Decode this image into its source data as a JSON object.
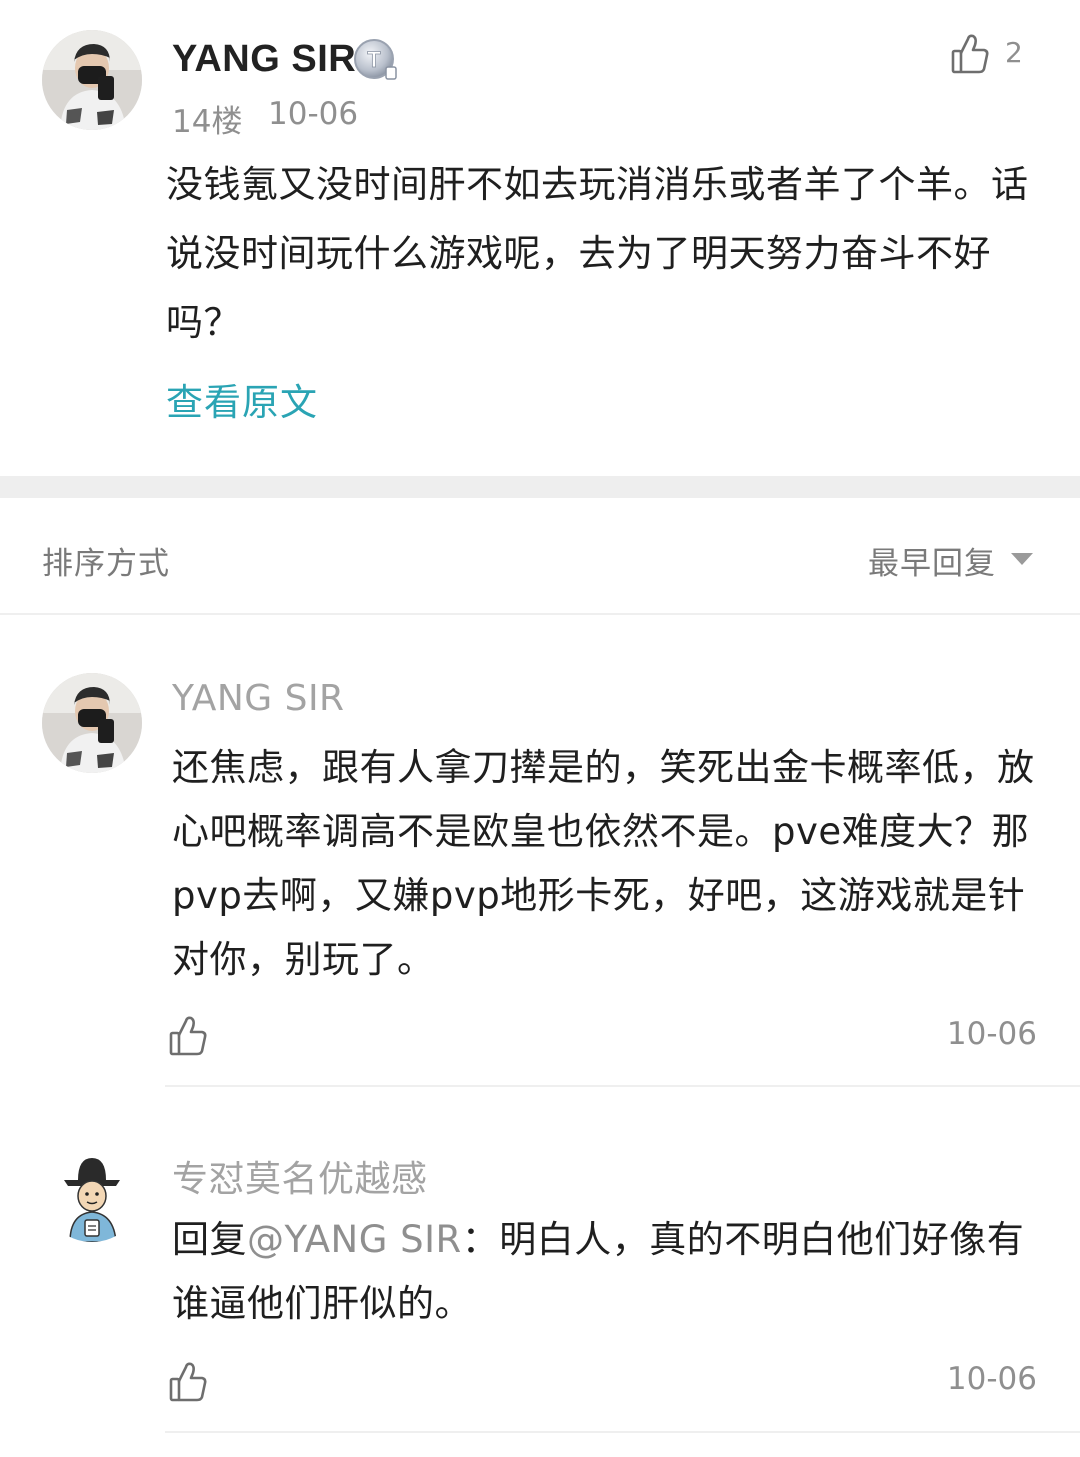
{
  "post": {
    "author": "YANG SIR",
    "badge_icon": "vip-t-badge-icon",
    "like_icon": "thumbs-up-icon",
    "like_count": "2",
    "floor": "14楼",
    "date": "10-06",
    "body": "没钱氪又没时间肝不如去玩消消乐或者羊了个羊。话说没时间玩什么游戏呢，去为了明天努力奋斗不好吗？",
    "view_original": "查看原文"
  },
  "sort": {
    "label": "排序方式",
    "value": "最早回复",
    "caret_icon": "caret-down-icon"
  },
  "replies": [
    {
      "author": "YANG SIR",
      "body": "还焦虑，跟有人拿刀撵是的，笑死出金卡概率低，放心吧概率调高不是欧皇也依然不是。pve难度大？那pvp去啊，又嫌pvp地形卡死，好吧，这游戏就是针对你，别玩了。",
      "date": "10-06",
      "like_icon": "thumbs-up-icon"
    },
    {
      "author": "专怼莫名优越感",
      "reply_prefix": "回复",
      "mention": "@YANG SIR",
      "body": "：明白人，真的不明白他们好像有谁逼他们肝似的。",
      "date": "10-06",
      "like_icon": "thumbs-up-icon"
    }
  ],
  "colors": {
    "link": "#2aa4b4",
    "text": "#1f1f1f",
    "muted": "#8f8f8f",
    "divider": "#efefef",
    "section_gap": "#eeeeee"
  }
}
